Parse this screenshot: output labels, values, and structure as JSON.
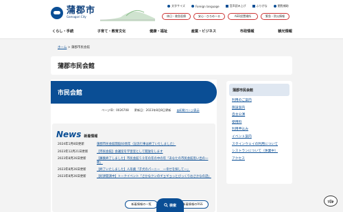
{
  "header": {
    "logo_main": "蒲郡市",
    "logo_sub": "Gamagori City",
    "utilities": [
      "文字サイズ",
      "Foreign language",
      "音声読み上げ",
      "ふりがな",
      "閲覧補助"
    ],
    "pills": [
      "休日・救急医療",
      "安心・ひろめーる",
      "AED設置場所",
      "緊急・防災情報"
    ]
  },
  "nav": [
    "くらし・手続",
    "子育て・教育文化",
    "健康・福祉",
    "産業・ビジネス",
    "市政情報",
    "観光情報"
  ],
  "breadcrumb": {
    "home": "ホーム",
    "sep": " > ",
    "current": "蒲郡市民会館"
  },
  "page_title": "蒲郡市民会館",
  "banner_title": "市民会館",
  "meta": {
    "page_id": "ページID：0026708",
    "updated": "更新日：2023年8月8日更新",
    "print": "印刷ページ表示"
  },
  "news": {
    "title_en": "News",
    "title_ja": "新着情報",
    "items": [
      {
        "date": "2024年1月8日更新",
        "text": "蒲郡市民会館開館60周年（記念行事は終了いたしました）"
      },
      {
        "date": "2023年12月21日更新",
        "text": "【市民会館】会議室を学習室として開放をします"
      },
      {
        "date": "2023年8月26日更新",
        "text": "【募集終了しました】市民会館５０年の年の中の年「あなたの市民会館思い出の一枚」"
      },
      {
        "date": "2023年8月26日更新",
        "text": "【終了いたしました】人形劇「子犬のパーニー　一幸せを探して一」"
      },
      {
        "date": "2023年8月26日更新",
        "text": "【好評開演中】トークイベント「さかなクンのギョギョっとびっくりおさかなの話」"
      }
    ],
    "btn_list": "新着情報の一覧",
    "btn_rss": "新着情報のRSS"
  },
  "search_fab": "検索",
  "sidebar": {
    "title": "蒲郡市民会館",
    "items": [
      "利用のご案内",
      "施設案内",
      "自主公演",
      "使用料",
      "利用申込み",
      "イベント案内",
      "スタインウェイの利用について",
      "シストランについて（休業中）",
      "アクセス"
    ]
  },
  "top_button": "TOP",
  "colors": {
    "brand": "#0a4e95",
    "accent": "#cc3333"
  }
}
